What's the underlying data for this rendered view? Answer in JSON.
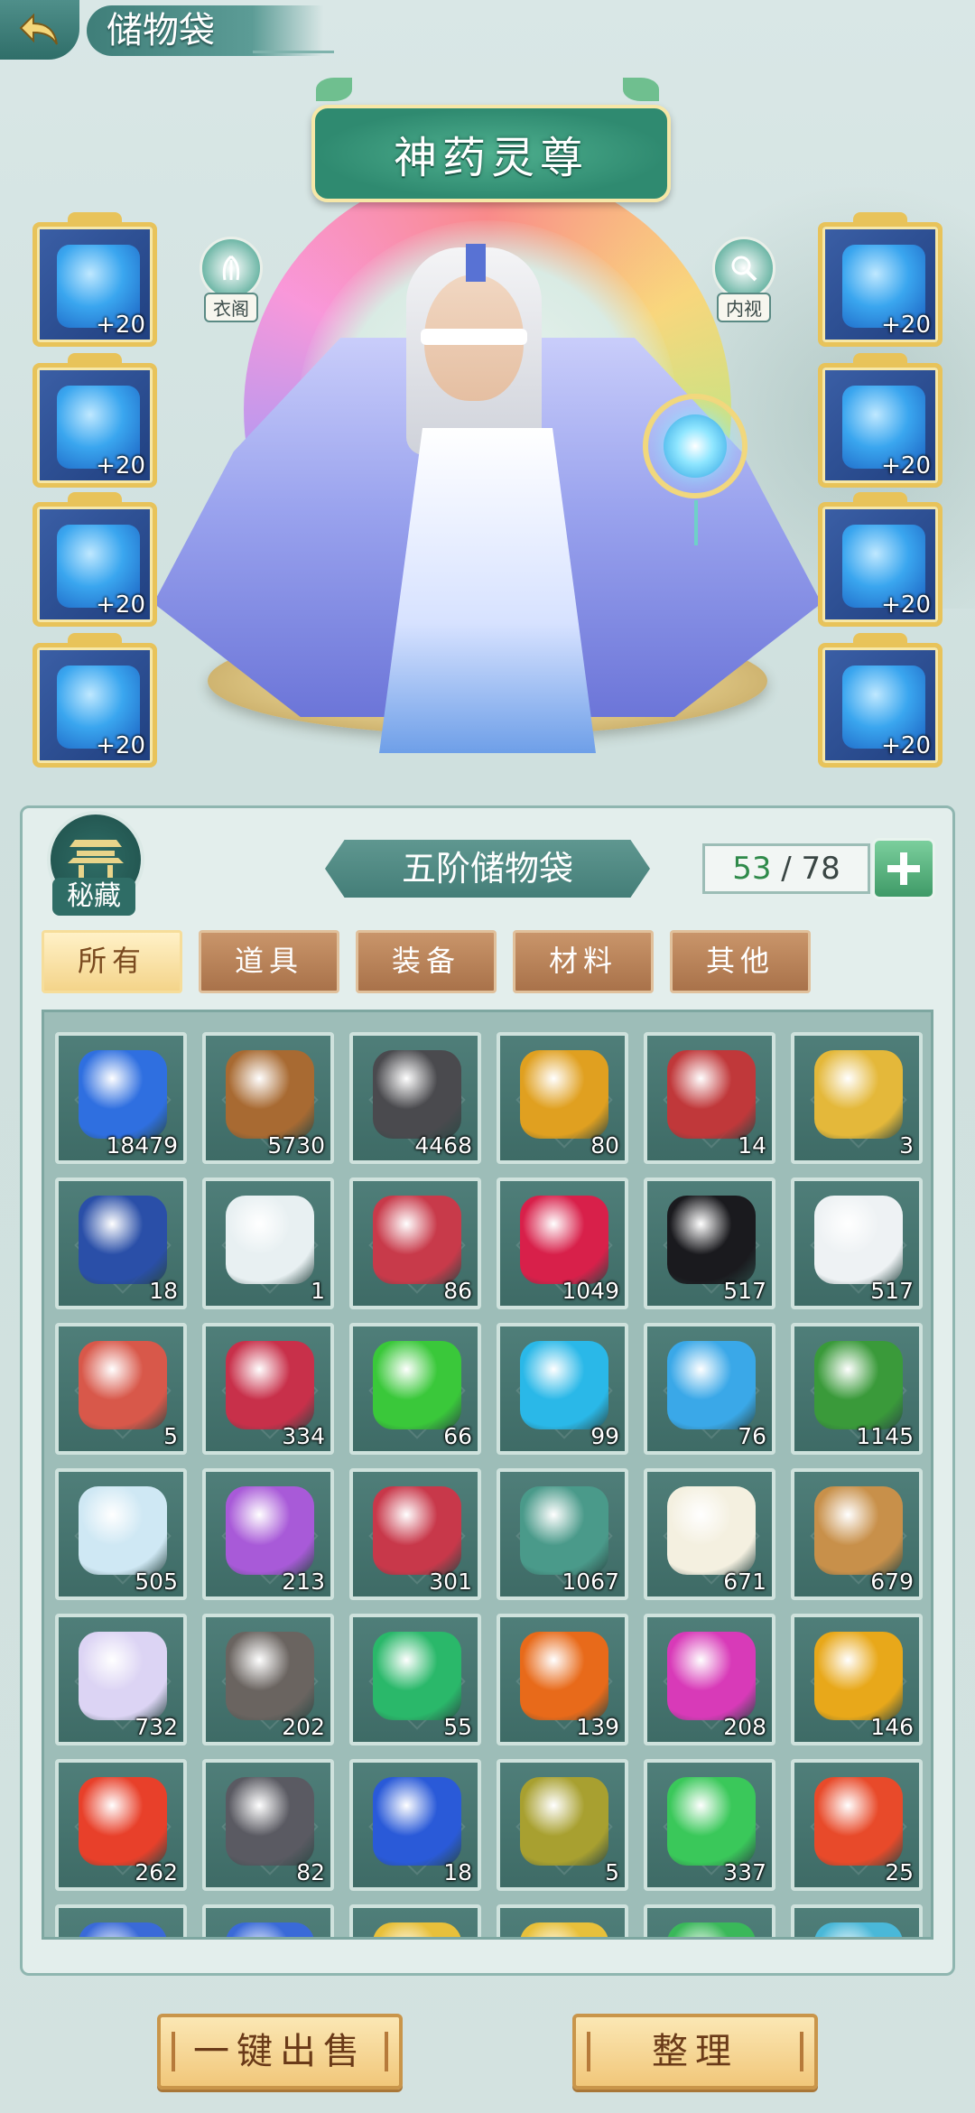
{
  "header": {
    "title": "储物袋"
  },
  "character": {
    "name": "神药灵尊"
  },
  "side_buttons": {
    "wardrobe_label": "衣阁",
    "inspect_label": "内视"
  },
  "equipment": {
    "left": [
      {
        "icon": "sword-icon",
        "level": "+20"
      },
      {
        "icon": "helmet-icon",
        "level": "+20"
      },
      {
        "icon": "robe-icon",
        "level": "+20"
      },
      {
        "icon": "boots-icon",
        "level": "+20"
      }
    ],
    "right": [
      {
        "icon": "ring-icon",
        "level": "+20"
      },
      {
        "icon": "pendant-icon",
        "level": "+20"
      },
      {
        "icon": "bracelet-icon",
        "level": "+20"
      },
      {
        "icon": "amulet-icon",
        "level": "+20"
      }
    ]
  },
  "bag": {
    "seal_label": "秘藏",
    "title": "五阶储物袋",
    "capacity_used": "53",
    "capacity_sep": " / ",
    "capacity_total": "78",
    "tabs": [
      "所有",
      "道具",
      "装备",
      "材料",
      "其他"
    ],
    "active_tab": 0
  },
  "items": [
    {
      "name": "blue-crystal-icon",
      "color": "#2f6fe0",
      "count": "18479"
    },
    {
      "name": "wood-log-icon",
      "color": "#a86a32",
      "count": "5730"
    },
    {
      "name": "dark-ore-icon",
      "color": "#4a4a4e",
      "count": "4468"
    },
    {
      "name": "dragon-orb-icon",
      "color": "#e0a020",
      "count": "80"
    },
    {
      "name": "gift-box-icon",
      "color": "#c0383a",
      "count": "14"
    },
    {
      "name": "gold-medallion-icon",
      "color": "#e4b83a",
      "count": "3"
    },
    {
      "name": "treasure-chest-icon",
      "color": "#2a4fa8",
      "count": "18"
    },
    {
      "name": "white-vase-icon",
      "color": "#e8f0f2",
      "count": "1"
    },
    {
      "name": "red-crystal-icon",
      "color": "#c83a4a",
      "count": "86"
    },
    {
      "name": "red-jade-icon",
      "color": "#d8204a",
      "count": "1049"
    },
    {
      "name": "black-jade-icon",
      "color": "#1a1a1e",
      "count": "517"
    },
    {
      "name": "white-jade-icon",
      "color": "#eef2f4",
      "count": "517"
    },
    {
      "name": "gourd-bottle-icon",
      "color": "#d8584a",
      "count": "5"
    },
    {
      "name": "ruby-cluster-icon",
      "color": "#c8304a",
      "count": "334"
    },
    {
      "name": "green-orb-icon",
      "color": "#3ac83a",
      "count": "66"
    },
    {
      "name": "cyan-orb-icon",
      "color": "#2ab8e8",
      "count": "99"
    },
    {
      "name": "blue-orb-icon",
      "color": "#3aa8e8",
      "count": "76"
    },
    {
      "name": "green-herb-icon",
      "color": "#3a9a3a",
      "count": "1145"
    },
    {
      "name": "ice-lotus-icon",
      "color": "#cfe8f4",
      "count": "505"
    },
    {
      "name": "purple-orchid-icon",
      "color": "#a85ad8",
      "count": "213"
    },
    {
      "name": "red-mushroom-icon",
      "color": "#c8384a",
      "count": "301"
    },
    {
      "name": "jade-branch-icon",
      "color": "#4a9a8a",
      "count": "1067"
    },
    {
      "name": "white-flower-icon",
      "color": "#f4f0e0",
      "count": "671"
    },
    {
      "name": "ginseng-root-icon",
      "color": "#c8904a",
      "count": "679"
    },
    {
      "name": "crystal-lotus-icon",
      "color": "#dcd4f4",
      "count": "732"
    },
    {
      "name": "gray-stone-icon",
      "color": "#6a6460",
      "count": "202"
    },
    {
      "name": "emerald-icon",
      "color": "#2ab86a",
      "count": "55"
    },
    {
      "name": "amber-crystal-icon",
      "color": "#e86a1a",
      "count": "139"
    },
    {
      "name": "magenta-gem-icon",
      "color": "#d83ab8",
      "count": "208"
    },
    {
      "name": "topaz-icon",
      "color": "#e8a81a",
      "count": "146"
    },
    {
      "name": "fire-crystal-icon",
      "color": "#e8402a",
      "count": "262"
    },
    {
      "name": "iron-ore-icon",
      "color": "#5a5a62",
      "count": "82"
    },
    {
      "name": "sapphire-icon",
      "color": "#2a5ad8",
      "count": "18"
    },
    {
      "name": "bronze-ball-icon",
      "color": "#a8a030",
      "count": "5"
    },
    {
      "name": "green-talisman-icon",
      "color": "#3ac85a",
      "count": "337"
    },
    {
      "name": "red-talisman-icon",
      "color": "#e84a2a",
      "count": "25"
    },
    {
      "name": "blue-item-icon",
      "color": "#3a6ad8",
      "count": ""
    },
    {
      "name": "blue-item-icon",
      "color": "#3a6ad8",
      "count": ""
    },
    {
      "name": "gold-item-icon",
      "color": "#e8c03a",
      "count": ""
    },
    {
      "name": "gold-item-icon",
      "color": "#e8c03a",
      "count": ""
    },
    {
      "name": "green-item-icon",
      "color": "#3ab85a",
      "count": ""
    },
    {
      "name": "cyan-item-icon",
      "color": "#4ab8d8",
      "count": ""
    }
  ],
  "actions": {
    "sell_all": "一键出售",
    "sort": "整理"
  }
}
